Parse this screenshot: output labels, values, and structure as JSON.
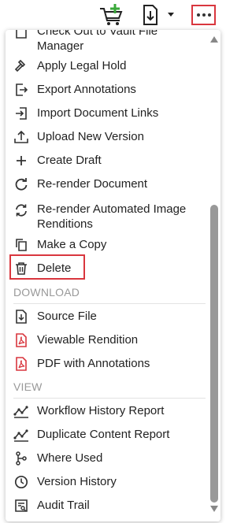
{
  "toolbar": {
    "cart_icon": "cart-add-icon",
    "doc_icon": "document-download-icon",
    "more_icon": "more-dots-icon"
  },
  "menu": {
    "partial_item": {
      "label_line1": "Check Out to Vault File",
      "label_line2": "Manager"
    },
    "items": [
      {
        "label": "Apply Legal Hold",
        "icon": "gavel-icon"
      },
      {
        "label": "Export Annotations",
        "icon": "export-icon"
      },
      {
        "label": "Import Document Links",
        "icon": "import-icon"
      },
      {
        "label": "Upload New Version",
        "icon": "upload-icon"
      },
      {
        "label": "Create Draft",
        "icon": "plus-icon"
      },
      {
        "label": "Re-render Document",
        "icon": "rerender-icon"
      },
      {
        "label": "Re-render Automated Image Renditions",
        "icon": "rerender-cycle-icon"
      },
      {
        "label": "Make a Copy",
        "icon": "copy-icon"
      },
      {
        "label": "Delete",
        "icon": "trash-icon"
      }
    ],
    "download_section": "DOWNLOAD",
    "download_items": [
      {
        "label": "Source File",
        "icon": "file-download-icon"
      },
      {
        "label": "Viewable Rendition",
        "icon": "pdf-icon"
      },
      {
        "label": "PDF with Annotations",
        "icon": "pdf-icon"
      }
    ],
    "view_section": "VIEW",
    "view_items": [
      {
        "label": "Workflow History Report",
        "icon": "report-icon"
      },
      {
        "label": "Duplicate Content Report",
        "icon": "report-icon"
      },
      {
        "label": "Where Used",
        "icon": "branch-icon"
      },
      {
        "label": "Version History",
        "icon": "clock-icon"
      },
      {
        "label": "Audit Trail",
        "icon": "audit-icon"
      }
    ]
  },
  "colors": {
    "highlight": "#d9363e",
    "cart_plus": "#3aa83a",
    "pdf_red": "#d9363e"
  }
}
